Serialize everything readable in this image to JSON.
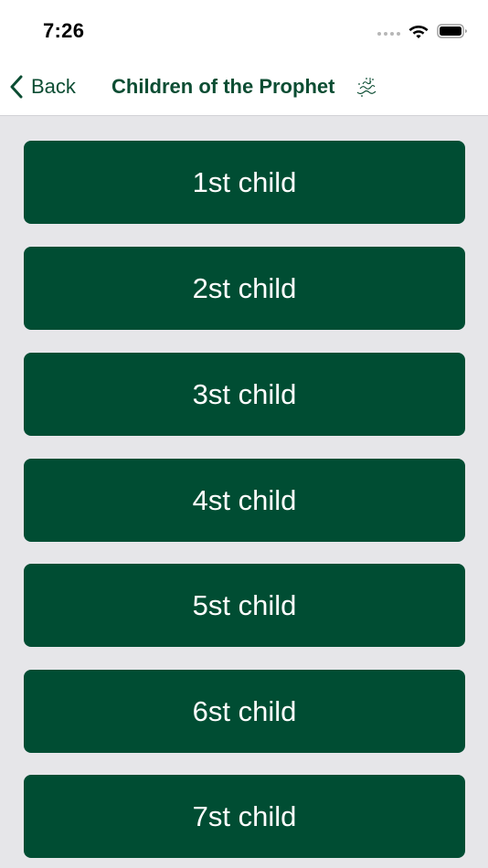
{
  "status_bar": {
    "time": "7:26",
    "icons": [
      "signal-icon",
      "wifi-icon",
      "battery-icon"
    ]
  },
  "nav": {
    "back_label": "Back",
    "title": "Children of the Prophet",
    "title_suffix_icon": "honorific-calligraphy-icon"
  },
  "children": [
    {
      "label": "1st child"
    },
    {
      "label": "2st child"
    },
    {
      "label": "3st child"
    },
    {
      "label": "4st child"
    },
    {
      "label": "5st child"
    },
    {
      "label": "6st child"
    },
    {
      "label": "7st child"
    }
  ],
  "colors": {
    "brand": "#004d33",
    "background": "#e6e6e9",
    "button_text": "#ffffff"
  }
}
